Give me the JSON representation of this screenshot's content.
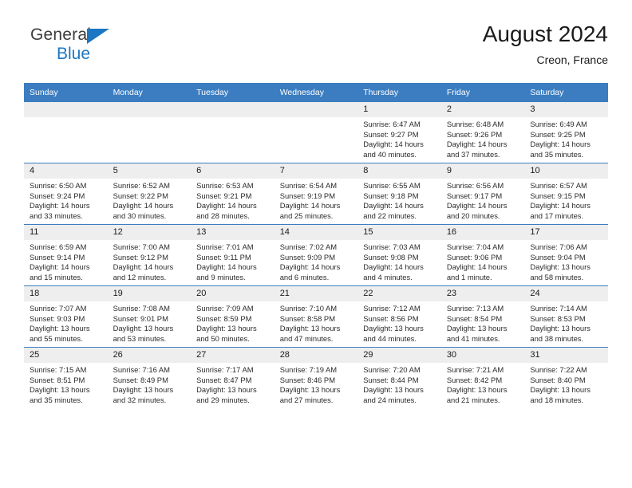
{
  "brand": {
    "name_top": "General",
    "name_bottom": "Blue",
    "triangle_color": "#1b77c3",
    "blue_text_color": "#1b77c3"
  },
  "header": {
    "title": "August 2024",
    "subtitle": "Creon, France"
  },
  "theme": {
    "header_bg": "#3b7dc0",
    "header_text": "#ffffff",
    "daynum_bg": "#eeeeee",
    "row_border": "#3b7dc0"
  },
  "weekdays": [
    "Sunday",
    "Monday",
    "Tuesday",
    "Wednesday",
    "Thursday",
    "Friday",
    "Saturday"
  ],
  "labels": {
    "sunrise_prefix": "Sunrise:",
    "sunset_prefix": "Sunset:",
    "daylight_prefix": "Daylight:"
  },
  "weeks": [
    [
      {
        "empty": true
      },
      {
        "empty": true
      },
      {
        "empty": true
      },
      {
        "empty": true
      },
      {
        "day": "1",
        "sunrise": "Sunrise: 6:47 AM",
        "sunset": "Sunset: 9:27 PM",
        "daylight_line1": "Daylight: 14 hours",
        "daylight_line2": "and 40 minutes."
      },
      {
        "day": "2",
        "sunrise": "Sunrise: 6:48 AM",
        "sunset": "Sunset: 9:26 PM",
        "daylight_line1": "Daylight: 14 hours",
        "daylight_line2": "and 37 minutes."
      },
      {
        "day": "3",
        "sunrise": "Sunrise: 6:49 AM",
        "sunset": "Sunset: 9:25 PM",
        "daylight_line1": "Daylight: 14 hours",
        "daylight_line2": "and 35 minutes."
      }
    ],
    [
      {
        "day": "4",
        "sunrise": "Sunrise: 6:50 AM",
        "sunset": "Sunset: 9:24 PM",
        "daylight_line1": "Daylight: 14 hours",
        "daylight_line2": "and 33 minutes."
      },
      {
        "day": "5",
        "sunrise": "Sunrise: 6:52 AM",
        "sunset": "Sunset: 9:22 PM",
        "daylight_line1": "Daylight: 14 hours",
        "daylight_line2": "and 30 minutes."
      },
      {
        "day": "6",
        "sunrise": "Sunrise: 6:53 AM",
        "sunset": "Sunset: 9:21 PM",
        "daylight_line1": "Daylight: 14 hours",
        "daylight_line2": "and 28 minutes."
      },
      {
        "day": "7",
        "sunrise": "Sunrise: 6:54 AM",
        "sunset": "Sunset: 9:19 PM",
        "daylight_line1": "Daylight: 14 hours",
        "daylight_line2": "and 25 minutes."
      },
      {
        "day": "8",
        "sunrise": "Sunrise: 6:55 AM",
        "sunset": "Sunset: 9:18 PM",
        "daylight_line1": "Daylight: 14 hours",
        "daylight_line2": "and 22 minutes."
      },
      {
        "day": "9",
        "sunrise": "Sunrise: 6:56 AM",
        "sunset": "Sunset: 9:17 PM",
        "daylight_line1": "Daylight: 14 hours",
        "daylight_line2": "and 20 minutes."
      },
      {
        "day": "10",
        "sunrise": "Sunrise: 6:57 AM",
        "sunset": "Sunset: 9:15 PM",
        "daylight_line1": "Daylight: 14 hours",
        "daylight_line2": "and 17 minutes."
      }
    ],
    [
      {
        "day": "11",
        "sunrise": "Sunrise: 6:59 AM",
        "sunset": "Sunset: 9:14 PM",
        "daylight_line1": "Daylight: 14 hours",
        "daylight_line2": "and 15 minutes."
      },
      {
        "day": "12",
        "sunrise": "Sunrise: 7:00 AM",
        "sunset": "Sunset: 9:12 PM",
        "daylight_line1": "Daylight: 14 hours",
        "daylight_line2": "and 12 minutes."
      },
      {
        "day": "13",
        "sunrise": "Sunrise: 7:01 AM",
        "sunset": "Sunset: 9:11 PM",
        "daylight_line1": "Daylight: 14 hours",
        "daylight_line2": "and 9 minutes."
      },
      {
        "day": "14",
        "sunrise": "Sunrise: 7:02 AM",
        "sunset": "Sunset: 9:09 PM",
        "daylight_line1": "Daylight: 14 hours",
        "daylight_line2": "and 6 minutes."
      },
      {
        "day": "15",
        "sunrise": "Sunrise: 7:03 AM",
        "sunset": "Sunset: 9:08 PM",
        "daylight_line1": "Daylight: 14 hours",
        "daylight_line2": "and 4 minutes."
      },
      {
        "day": "16",
        "sunrise": "Sunrise: 7:04 AM",
        "sunset": "Sunset: 9:06 PM",
        "daylight_line1": "Daylight: 14 hours",
        "daylight_line2": "and 1 minute."
      },
      {
        "day": "17",
        "sunrise": "Sunrise: 7:06 AM",
        "sunset": "Sunset: 9:04 PM",
        "daylight_line1": "Daylight: 13 hours",
        "daylight_line2": "and 58 minutes."
      }
    ],
    [
      {
        "day": "18",
        "sunrise": "Sunrise: 7:07 AM",
        "sunset": "Sunset: 9:03 PM",
        "daylight_line1": "Daylight: 13 hours",
        "daylight_line2": "and 55 minutes."
      },
      {
        "day": "19",
        "sunrise": "Sunrise: 7:08 AM",
        "sunset": "Sunset: 9:01 PM",
        "daylight_line1": "Daylight: 13 hours",
        "daylight_line2": "and 53 minutes."
      },
      {
        "day": "20",
        "sunrise": "Sunrise: 7:09 AM",
        "sunset": "Sunset: 8:59 PM",
        "daylight_line1": "Daylight: 13 hours",
        "daylight_line2": "and 50 minutes."
      },
      {
        "day": "21",
        "sunrise": "Sunrise: 7:10 AM",
        "sunset": "Sunset: 8:58 PM",
        "daylight_line1": "Daylight: 13 hours",
        "daylight_line2": "and 47 minutes."
      },
      {
        "day": "22",
        "sunrise": "Sunrise: 7:12 AM",
        "sunset": "Sunset: 8:56 PM",
        "daylight_line1": "Daylight: 13 hours",
        "daylight_line2": "and 44 minutes."
      },
      {
        "day": "23",
        "sunrise": "Sunrise: 7:13 AM",
        "sunset": "Sunset: 8:54 PM",
        "daylight_line1": "Daylight: 13 hours",
        "daylight_line2": "and 41 minutes."
      },
      {
        "day": "24",
        "sunrise": "Sunrise: 7:14 AM",
        "sunset": "Sunset: 8:53 PM",
        "daylight_line1": "Daylight: 13 hours",
        "daylight_line2": "and 38 minutes."
      }
    ],
    [
      {
        "day": "25",
        "sunrise": "Sunrise: 7:15 AM",
        "sunset": "Sunset: 8:51 PM",
        "daylight_line1": "Daylight: 13 hours",
        "daylight_line2": "and 35 minutes."
      },
      {
        "day": "26",
        "sunrise": "Sunrise: 7:16 AM",
        "sunset": "Sunset: 8:49 PM",
        "daylight_line1": "Daylight: 13 hours",
        "daylight_line2": "and 32 minutes."
      },
      {
        "day": "27",
        "sunrise": "Sunrise: 7:17 AM",
        "sunset": "Sunset: 8:47 PM",
        "daylight_line1": "Daylight: 13 hours",
        "daylight_line2": "and 29 minutes."
      },
      {
        "day": "28",
        "sunrise": "Sunrise: 7:19 AM",
        "sunset": "Sunset: 8:46 PM",
        "daylight_line1": "Daylight: 13 hours",
        "daylight_line2": "and 27 minutes."
      },
      {
        "day": "29",
        "sunrise": "Sunrise: 7:20 AM",
        "sunset": "Sunset: 8:44 PM",
        "daylight_line1": "Daylight: 13 hours",
        "daylight_line2": "and 24 minutes."
      },
      {
        "day": "30",
        "sunrise": "Sunrise: 7:21 AM",
        "sunset": "Sunset: 8:42 PM",
        "daylight_line1": "Daylight: 13 hours",
        "daylight_line2": "and 21 minutes."
      },
      {
        "day": "31",
        "sunrise": "Sunrise: 7:22 AM",
        "sunset": "Sunset: 8:40 PM",
        "daylight_line1": "Daylight: 13 hours",
        "daylight_line2": "and 18 minutes."
      }
    ]
  ]
}
